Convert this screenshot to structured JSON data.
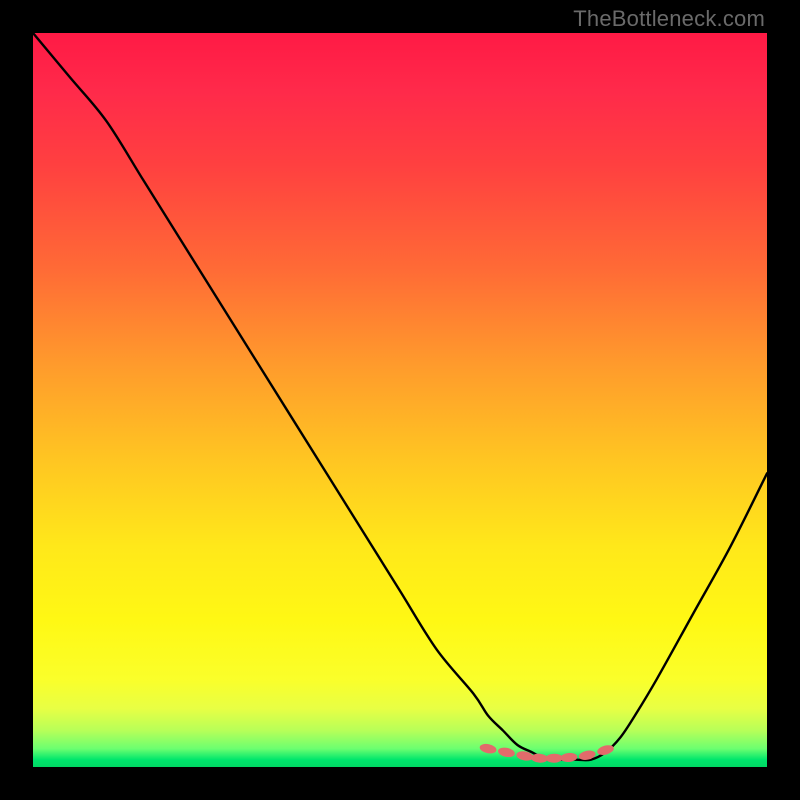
{
  "watermark": "TheBottleneck.com",
  "chart_data": {
    "type": "line",
    "title": "",
    "xlabel": "",
    "ylabel": "",
    "x_range": [
      0,
      100
    ],
    "y_range": [
      0,
      100
    ],
    "grid": false,
    "legend": false,
    "series": [
      {
        "name": "bottleneck-curve",
        "x": [
          0,
          5,
          10,
          15,
          20,
          25,
          30,
          35,
          40,
          45,
          50,
          55,
          60,
          62,
          64,
          66,
          68,
          70,
          72,
          74,
          76,
          78,
          80,
          82,
          85,
          90,
          95,
          100
        ],
        "y": [
          100,
          94,
          88,
          80,
          72,
          64,
          56,
          48,
          40,
          32,
          24,
          16,
          10,
          7,
          5,
          3,
          2,
          1,
          1,
          1,
          1,
          2,
          4,
          7,
          12,
          21,
          30,
          40
        ]
      },
      {
        "name": "optimal-markers",
        "x": [
          62,
          64.5,
          67,
          69,
          71,
          73,
          75.5,
          78
        ],
        "y": [
          2.5,
          2,
          1.5,
          1.2,
          1.2,
          1.3,
          1.6,
          2.3
        ]
      }
    ],
    "gradient_stops": [
      {
        "pos": 0,
        "color": "#ff1a45"
      },
      {
        "pos": 0.5,
        "color": "#ffc522"
      },
      {
        "pos": 0.85,
        "color": "#fff814"
      },
      {
        "pos": 1.0,
        "color": "#00d864"
      }
    ]
  }
}
